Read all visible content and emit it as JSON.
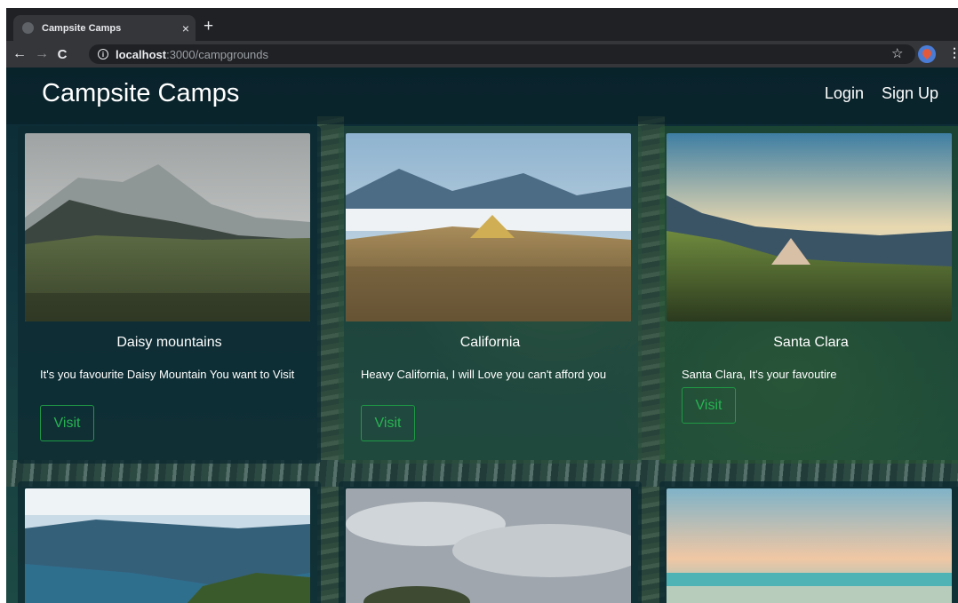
{
  "browser": {
    "tab_title": "Campsite Camps",
    "tab_close": "×",
    "new_tab": "+",
    "url_host": "localhost",
    "url_path": ":3000/campgrounds",
    "back": "←",
    "forward": "→",
    "reload": "C",
    "star": "☆",
    "menu": "⋮"
  },
  "navbar": {
    "brand": "Campsite Camps",
    "login": "Login",
    "signup": "Sign Up"
  },
  "campgrounds": [
    {
      "title": "Daisy mountains",
      "description": "It's you favourite Daisy Mountain You want to Visit",
      "button": "Visit"
    },
    {
      "title": "California",
      "description": "Heavy California, I will Love you can't afford you",
      "button": "Visit"
    },
    {
      "title": "Santa Clara",
      "description": "Santa Clara, It's your favoutire",
      "button": "Visit"
    }
  ]
}
